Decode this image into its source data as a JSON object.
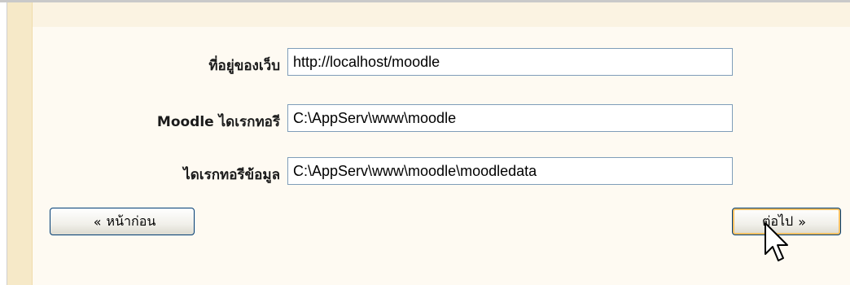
{
  "form": {
    "fields": [
      {
        "label": "ที่อยู่ของเว็บ",
        "value": "http://localhost/moodle"
      },
      {
        "label": "Moodle ไดเรกทอรี",
        "value": "C:\\AppServ\\www\\moodle"
      },
      {
        "label": "ไดเรกทอรีข้อมูล",
        "value": "C:\\AppServ\\www\\moodle\\moodledata"
      }
    ]
  },
  "buttons": {
    "prev_arrow": "«",
    "prev_label": "หน้าก่อน",
    "next_label": "ต่อไป",
    "next_arrow": "»"
  },
  "colors": {
    "panel_background": "#fefaf2",
    "accent": "#f6e9c8",
    "field_border": "#7f9db9",
    "button_border": "#003c74",
    "focus_highlight": "#f5c063"
  },
  "icons": {
    "cursor": "mouse-pointer-icon"
  }
}
